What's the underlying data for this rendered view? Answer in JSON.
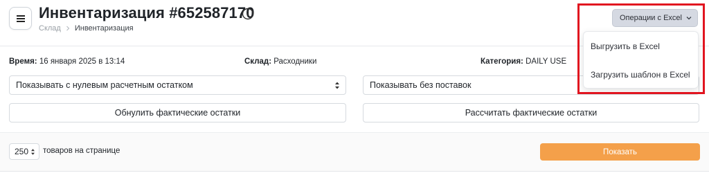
{
  "header": {
    "title": "Инвентаризация #652587170",
    "breadcrumb": [
      "Склад",
      "Инвентаризация"
    ],
    "menu_icon": "hamburger-icon",
    "info_icon": "info-icon"
  },
  "meta": {
    "time_label": "Время:",
    "time_value": "16 января 2025 в 13:14",
    "warehouse_label": "Склад:",
    "warehouse_value": "Расходники",
    "category_label": "Категория:",
    "category_value": "DAILY USE"
  },
  "filters": {
    "stock_filter": "Показывать с нулевым расчетным остатком",
    "supply_filter": "Показывать без поставок"
  },
  "actions": {
    "reset_label": "Обнулить фактические остатки",
    "calculate_label": "Рассчитать фактические остатки"
  },
  "pagination": {
    "per_page_value": "250",
    "per_page_label": "товаров на странице",
    "show_label": "Показать"
  },
  "excel_menu": {
    "button_label": "Операции с Excel",
    "items": [
      "Выгрузить в Excel",
      "Загрузить шаблон в Excel"
    ]
  },
  "colors": {
    "accent": "#f4a04a",
    "highlight": "#e1141f",
    "excel_button": "#d5d9e2"
  }
}
